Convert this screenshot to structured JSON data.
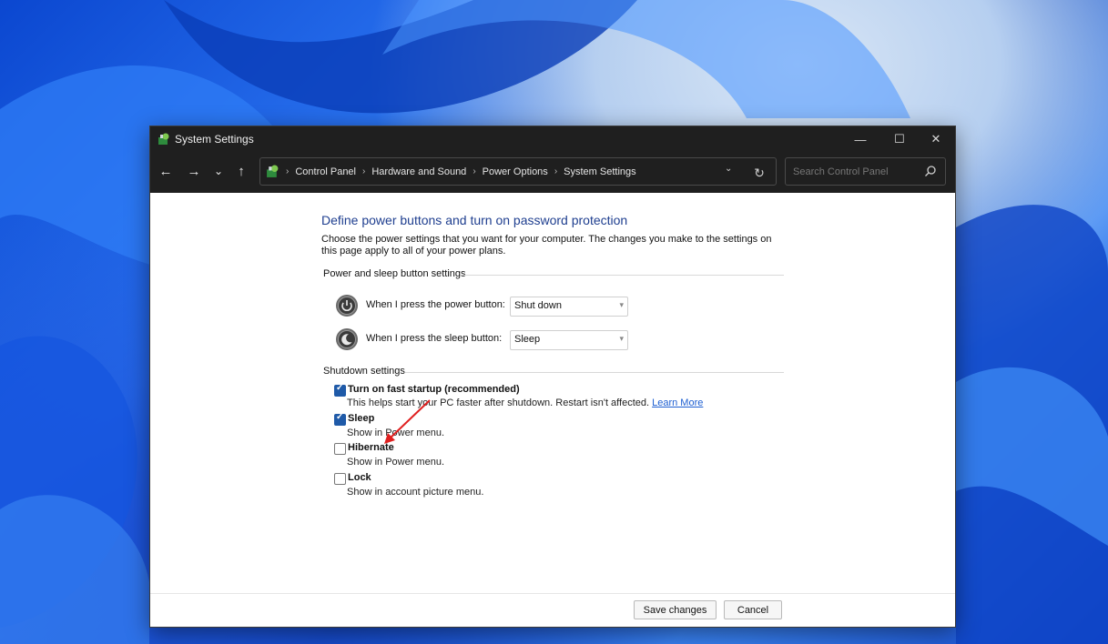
{
  "window": {
    "title": "System Settings",
    "controls": {
      "minimize": "—",
      "maximize": "☐",
      "close": "✕"
    }
  },
  "nav": {
    "back": "←",
    "forward": "→",
    "recent": "⌄",
    "up": "↑",
    "breadcrumbs": [
      "Control Panel",
      "Hardware and Sound",
      "Power Options",
      "System Settings"
    ],
    "dropdown": "⌄",
    "refresh": "↻",
    "search_placeholder": "Search Control Panel"
  },
  "content": {
    "heading": "Define power buttons and turn on password protection",
    "description": "Choose the power settings that you want for your computer. The changes you make to the settings on this page apply to all of your power plans.",
    "power_sleep_group": "Power and sleep button settings",
    "power_button": {
      "label": "When I press the power button:",
      "value": "Shut down"
    },
    "sleep_button": {
      "label": "When I press the sleep button:",
      "value": "Sleep"
    },
    "shutdown_group": "Shutdown settings",
    "options": [
      {
        "title": "Turn on fast startup (recommended)",
        "sub": "This helps start your PC faster after shutdown. Restart isn't affected.",
        "link": "Learn More",
        "checked": true
      },
      {
        "title": "Sleep",
        "sub": "Show in Power menu.",
        "checked": true
      },
      {
        "title": "Hibernate",
        "sub": "Show in Power menu.",
        "checked": false
      },
      {
        "title": "Lock",
        "sub": "Show in account picture menu.",
        "checked": false
      }
    ]
  },
  "footer": {
    "save": "Save changes",
    "cancel": "Cancel"
  },
  "colors": {
    "heading": "#1e3e8f",
    "link": "#1c5ed1",
    "checkbox": "#1f5aa8",
    "annotation_arrow": "#e02020"
  }
}
